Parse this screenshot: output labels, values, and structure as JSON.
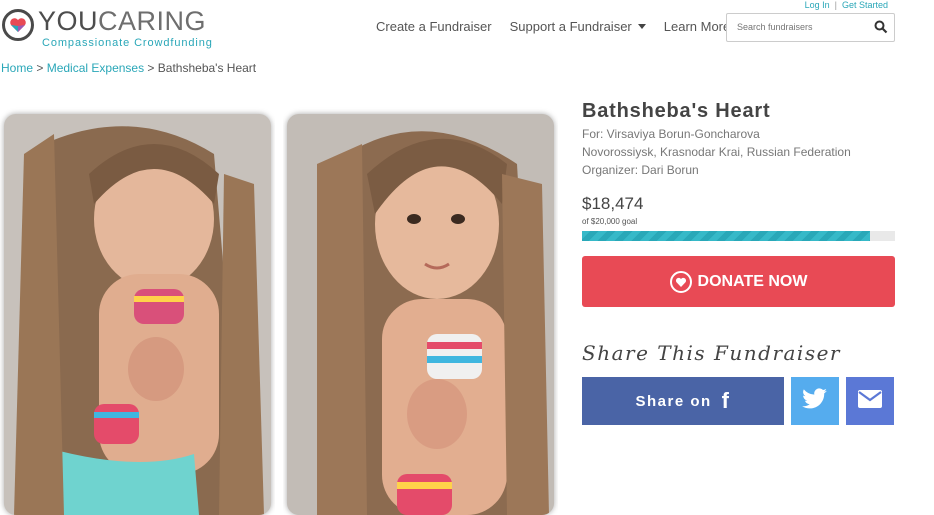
{
  "brand": {
    "name_part1": "YOU",
    "name_part2": "CARING",
    "tagline": "Compassionate Crowdfunding"
  },
  "toplinks": {
    "login": "Log In",
    "get_started": "Get Started"
  },
  "nav": {
    "create": "Create a Fundraiser",
    "support": "Support a Fundraiser",
    "learn": "Learn More"
  },
  "search": {
    "placeholder": "Search fundraisers"
  },
  "breadcrumb": {
    "home": "Home",
    "category": "Medical Expenses",
    "current": "Bathsheba's Heart"
  },
  "campaign": {
    "title": "Bathsheba's Heart",
    "for": "For: Virsaviya Borun-Goncharova",
    "location": "Novorossiysk, Krasnodar Krai, Russian Federation",
    "organizer": "Organizer: Dari Borun",
    "raised": "$18,474",
    "goal": "of $20,000 goal",
    "progress_fraction": 0.92
  },
  "donate": {
    "label": "DONATE NOW"
  },
  "share": {
    "title": "Share This Fundraiser",
    "facebook_label": "Share on",
    "facebook_glyph": "f"
  },
  "colors": {
    "accent": "#2aa7b8",
    "donate": "#e84a55",
    "facebook": "#4a64a6",
    "twitter": "#55acee",
    "email": "#5b78d6"
  }
}
